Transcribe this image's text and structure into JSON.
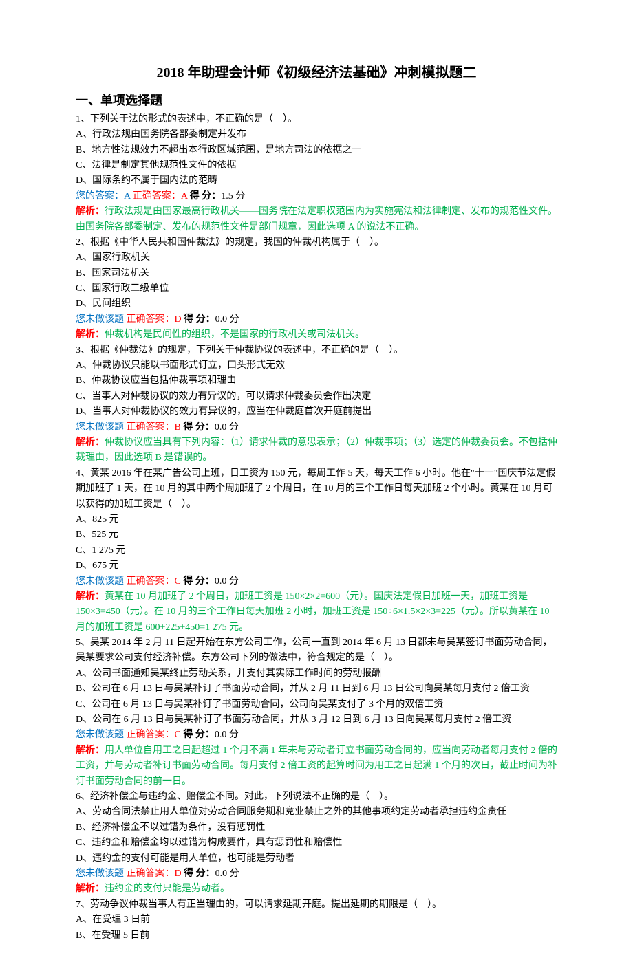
{
  "title": "2018 年助理会计师《初级经济法基础》冲刺模拟题二",
  "section": "一、单项选择题",
  "labels": {
    "yourAnswer": "您的答案：",
    "notDone": "您未做该题",
    "correctAnswer": "正确答案：",
    "score": "得 分：",
    "analysis": "解析："
  },
  "questions": [
    {
      "stem": "1、下列关于法的形式的表述中，不正确的是（　）。",
      "options": [
        "A、行政法规由国务院各部委制定并发布",
        "B、地方性法规效力不超出本行政区域范围，是地方司法的依据之一",
        "C、法律是制定其他规范性文件的依据",
        "D、国际条约不属于国内法的范畴"
      ],
      "userAnswer": "A",
      "correct": "A",
      "score": "1.5 分",
      "analysis": "行政法规是由国家最高行政机关——国务院在法定职权范围内为实施宪法和法律制定、发布的规范性文件。由国务院各部委制定、发布的规范性文件是部门规章，因此选项 A 的说法不正确。"
    },
    {
      "stem": "2、根据《中华人民共和国仲裁法》的规定，我国的仲裁机构属于（　）。",
      "options": [
        "A、国家行政机关",
        "B、国家司法机关",
        "C、国家行政二级单位",
        "D、民间组织"
      ],
      "correct": "D",
      "score": "0.0 分",
      "analysis": "仲裁机构是民间性的组织，不是国家的行政机关或司法机关。"
    },
    {
      "stem": "3、根据《仲裁法》的规定，下列关于仲裁协议的表述中，不正确的是（　）。",
      "options": [
        "A、仲裁协议只能以书面形式订立，口头形式无效",
        "B、仲裁协议应当包括仲裁事项和理由",
        "C、当事人对仲裁协议的效力有异议的，可以请求仲裁委员会作出决定",
        "D、当事人对仲裁协议的效力有异议的，应当在仲裁庭首次开庭前提出"
      ],
      "correct": "B",
      "score": "0.0 分",
      "analysis": "仲裁协议应当具有下列内容：（1）请求仲裁的意思表示；（2）仲裁事项；（3）选定的仲裁委员会。不包括仲裁理由，因此选项 B 是错误的。"
    },
    {
      "stem": "4、黄某 2016 年在某广告公司上班，日工资为 150 元，每周工作 5 天，每天工作 6 小时。他在\"十一\"国庆节法定假期加班了 1 天，在 10 月的其中两个周加班了 2 个周日，在 10 月的三个工作日每天加班 2 个小时。黄某在 10 月可以获得的加班工资是（　）。",
      "options": [
        "A、825 元",
        "B、525 元",
        "C、1 275 元",
        "D、675 元"
      ],
      "correct": "C",
      "score": "0.0 分",
      "analysis": "黄某在 10 月加班了 2 个周日，加班工资是 150×2×2=600（元）。国庆法定假日加班一天，加班工资是 150×3=450（元）。在 10 月的三个工作日每天加班 2 小时，加班工资是 150÷6×1.5×2×3=225（元）。所以黄某在 10 月的加班工资是 600+225+450=1 275 元。"
    },
    {
      "stem": "5、吴某 2014 年 2 月 11 日起开始在东方公司工作，公司一直到 2014 年 6 月 13 日都未与吴某签订书面劳动合同，吴某要求公司支付经济补偿。东方公司下列的做法中，符合规定的是（　）。",
      "options": [
        "A、公司书面通知吴某终止劳动关系，并支付其实际工作时间的劳动报酬",
        "B、公司在 6 月 13 日与吴某补订了书面劳动合同，并从 2 月 11 日到 6 月 13 日公司向吴某每月支付 2 倍工资",
        "C、公司在 6 月 13 日与吴某补订了书面劳动合同，公司向吴某支付了 3 个月的双倍工资",
        "D、公司在 6 月 13 日与吴某补订了书面劳动合同，并从 3 月 12 日到 6 月 13 日向吴某每月支付 2 倍工资"
      ],
      "correct": "C",
      "score": "0.0 分",
      "analysis": "用人单位自用工之日起超过 1 个月不满 1 年未与劳动者订立书面劳动合同的，应当向劳动者每月支付 2 倍的工资，并与劳动者补订书面劳动合同。每月支付 2 倍工资的起算时间为用工之日起满 1 个月的次日，截止时间为补订书面劳动合同的前一日。"
    },
    {
      "stem": "6、经济补偿金与违约金、赔偿金不同。对此，下列说法不正确的是（　）。",
      "options": [
        "A、劳动合同法禁止用人单位对劳动合同服务期和竞业禁止之外的其他事项约定劳动者承担违约金责任",
        "B、经济补偿金不以过错为条件，没有惩罚性",
        "C、违约金和赔偿金均以过错为构成要件，具有惩罚性和赔偿性",
        "D、违约金的支付可能是用人单位，也可能是劳动者"
      ],
      "correct": "D",
      "score": "0.0 分",
      "analysis": "违约金的支付只能是劳动者。"
    },
    {
      "stem": "7、劳动争议仲裁当事人有正当理由的，可以请求延期开庭。提出延期的期限是（　）。",
      "options": [
        "A、在受理 3 日前",
        "B、在受理 5 日前"
      ]
    }
  ]
}
